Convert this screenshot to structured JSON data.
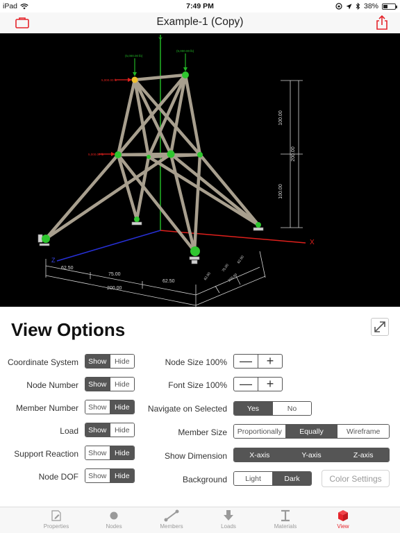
{
  "status_bar": {
    "device": "iPad",
    "time": "7:49 PM",
    "battery": "38%",
    "battery_level": 0.38
  },
  "nav": {
    "title": "Example-1 (Copy)",
    "left_icon": "folder-icon",
    "right_icon": "share-icon"
  },
  "viewport": {
    "axis_labels": {
      "x": "X",
      "y": "Y",
      "z": "Z"
    },
    "load_labels": [
      "(5,000.00 lb)",
      "(5,000.00 lb)",
      "5,000.00 lb",
      "5,000.00 lb"
    ],
    "vertical_dimensions": [
      "100.00",
      "100.00",
      "200.00"
    ],
    "front_dimensions": [
      "62.50",
      "75.00",
      "62.50",
      "200.00"
    ],
    "side_dimensions": [
      "62.50",
      "75.00",
      "62.50",
      "200.00"
    ]
  },
  "panel": {
    "title": "View Options",
    "left_options": [
      {
        "label": "Coordinate System",
        "on": "Show",
        "off": "Hide",
        "selected": "Show"
      },
      {
        "label": "Node Number",
        "on": "Show",
        "off": "Hide",
        "selected": "Show"
      },
      {
        "label": "Member Number",
        "on": "Show",
        "off": "Hide",
        "selected": "Hide"
      },
      {
        "label": "Load",
        "on": "Show",
        "off": "Hide",
        "selected": "Show"
      },
      {
        "label": "Support Reaction",
        "on": "Show",
        "off": "Hide",
        "selected": "Hide"
      },
      {
        "label": "Node DOF",
        "on": "Show",
        "off": "Hide",
        "selected": "Hide"
      }
    ],
    "node_size": {
      "label": "Node Size 100%",
      "minus": "—",
      "plus": "+"
    },
    "font_size": {
      "label": "Font Size 100%",
      "minus": "—",
      "plus": "+"
    },
    "navigate": {
      "label": "Navigate on Selected",
      "options": [
        "Yes",
        "No"
      ],
      "selected": "Yes"
    },
    "member_size": {
      "label": "Member Size",
      "options": [
        "Proportionally",
        "Equally",
        "Wireframe"
      ],
      "selected": "Equally"
    },
    "show_dimension": {
      "label": "Show Dimension",
      "options": [
        "X-axis",
        "Y-axis",
        "Z-axis"
      ],
      "selected": [
        "X-axis",
        "Y-axis",
        "Z-axis"
      ]
    },
    "background": {
      "label": "Background",
      "options": [
        "Light",
        "Dark"
      ],
      "selected": "Dark"
    },
    "color_settings": "Color Settings"
  },
  "tabs": [
    {
      "label": "Properties",
      "icon": "properties-icon"
    },
    {
      "label": "Nodes",
      "icon": "nodes-icon"
    },
    {
      "label": "Members",
      "icon": "members-icon"
    },
    {
      "label": "Loads",
      "icon": "loads-icon"
    },
    {
      "label": "Materials",
      "icon": "materials-icon"
    },
    {
      "label": "View",
      "icon": "view-cube-icon",
      "active": true
    }
  ],
  "colors": {
    "accent": "#e5232a",
    "segment_dark": "#555555",
    "member": "#a89f8e",
    "node": "#2fc62f",
    "axis_x": "#e0201c",
    "axis_y": "#22b526",
    "axis_z": "#2730d6"
  }
}
